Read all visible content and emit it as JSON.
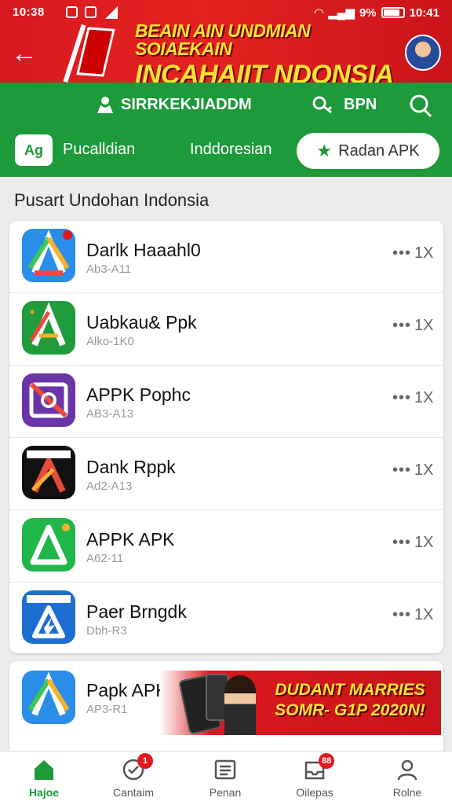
{
  "status_bar": {
    "time_left": "10:38",
    "battery_text": "9%",
    "time_right": "10:41"
  },
  "header": {
    "banner_line1": "BEAIN AIN UNDMIAN SOIAEKAIN",
    "banner_line2": "INCAHAIIT NDONSIA"
  },
  "nav": {
    "items": [
      {
        "label": "SIRRKEKJIADDM",
        "icon": "user-icon"
      },
      {
        "label": "BPN",
        "icon": "key-icon"
      }
    ],
    "search_icon": "search-icon"
  },
  "tabs": {
    "logo_text": "Ag",
    "items": [
      {
        "label": "Pucalldian"
      },
      {
        "label": "Inddoresian"
      }
    ],
    "active": {
      "label": "Radan APK",
      "icon": "star-icon"
    }
  },
  "section_title": "Pusart Undohan Indonsia",
  "apps": [
    {
      "name": "Darlk Haaahl0",
      "sub": "Ab3-A11",
      "more": "•••",
      "close": "1X"
    },
    {
      "name": "Uabkau& Ppk",
      "sub": "Alko-1K0",
      "more": "•••",
      "close": "1X"
    },
    {
      "name": "APPK Pophc",
      "sub": "AB3-A13",
      "more": "•••",
      "close": "1X"
    },
    {
      "name": "Dank Rppk",
      "sub": "Ad2-A13",
      "more": "•••",
      "close": "1X"
    },
    {
      "name": "APPK APK",
      "sub": "A62-11",
      "more": "•••",
      "close": "1X"
    },
    {
      "name": "Paer Brngdk",
      "sub": "Dbh-R3",
      "more": "•••",
      "close": "1X"
    }
  ],
  "promo_app": {
    "name": "Papk APK",
    "sub": "AP3-R1"
  },
  "promo_banner": {
    "line1": "DUDANT MARRIES",
    "line2": "SOMR- G1P 2020N!"
  },
  "bottom_nav": [
    {
      "label": "Hajoe",
      "icon": "home-icon",
      "active": true
    },
    {
      "label": "Cantaim",
      "icon": "check-circle-icon",
      "badge": "1"
    },
    {
      "label": "Penan",
      "icon": "list-icon"
    },
    {
      "label": "Oilepas",
      "icon": "inbox-icon",
      "badge": "88"
    },
    {
      "label": "Rolne",
      "icon": "profile-icon"
    }
  ],
  "colors": {
    "header_red": "#d8191f",
    "nav_green": "#1d9a3a",
    "banner_yellow": "#ffe234",
    "badge_red": "#e0191e"
  }
}
